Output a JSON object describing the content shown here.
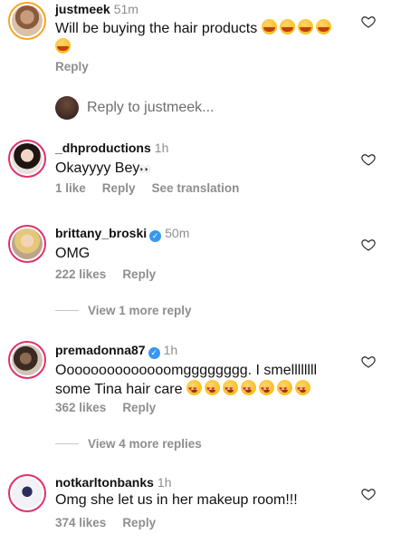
{
  "comments": [
    {
      "username": "justmeek",
      "time": "51m",
      "text": "Will be buying the hair products",
      "reply": "Reply"
    },
    {
      "username": "_dhproductions",
      "time": "1h",
      "text": "Okayyyy Bey",
      "likes": "1 like",
      "reply": "Reply",
      "translate": "See translation"
    },
    {
      "username": "brittany_broski",
      "time": "50m",
      "text": "OMG",
      "likes": "222 likes",
      "reply": "Reply",
      "view_more": "View 1 more reply"
    },
    {
      "username": "premadonna87",
      "time": "1h",
      "text_line1": "Oooooooooooooomgggggggg. I smellllllll",
      "text_line2": "some Tina hair care",
      "likes": "362 likes",
      "reply": "Reply",
      "view_more": "View 4 more replies"
    },
    {
      "username": "notkarltonbanks",
      "time": "1h",
      "text": "Omg she let us in her makeup room!!!",
      "likes": "374 likes",
      "reply": "Reply"
    }
  ],
  "reply_to": "Reply to justmeek...",
  "verified_mark": "✓",
  "icons": {
    "like": "heart-outline-icon",
    "verified": "verified-badge-icon",
    "emoji_hug": "smiling-face-with-hearts",
    "emoji_heart_eyes": "heart-eyes",
    "emoji_eyes": "eyes"
  },
  "colors": {
    "username": "#111111",
    "secondary": "#8e8e8e",
    "verified": "#3897f0"
  }
}
